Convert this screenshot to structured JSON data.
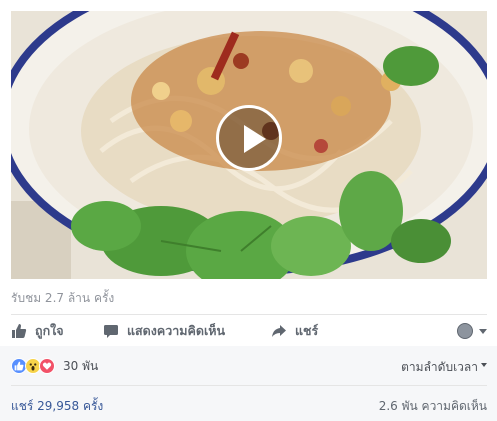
{
  "video": {
    "thumbnail_icon": "food-noodle-salad-image",
    "play_icon": "play-icon"
  },
  "views_text": "รับชม 2.7 ล้าน ครั้ง",
  "actions": {
    "like_label": "ถูกใจ",
    "comment_label": "แสดงความคิดเห็น",
    "share_label": "แชร์"
  },
  "reactions": {
    "icons": [
      "like-icon",
      "wow-icon",
      "love-icon"
    ],
    "count": "30 พัน"
  },
  "sort_label": "ตามลำดับเวลา",
  "shares_text": "แชร์ 29,958 ครั้ง",
  "comments_text": "2.6 พัน ความคิดเห็น",
  "colors": {
    "link": "#385898",
    "muted": "#90949c",
    "like": "#5890ff",
    "wow": "#f7d34a",
    "love": "#f25268",
    "footer_bg": "#f6f7f9"
  }
}
